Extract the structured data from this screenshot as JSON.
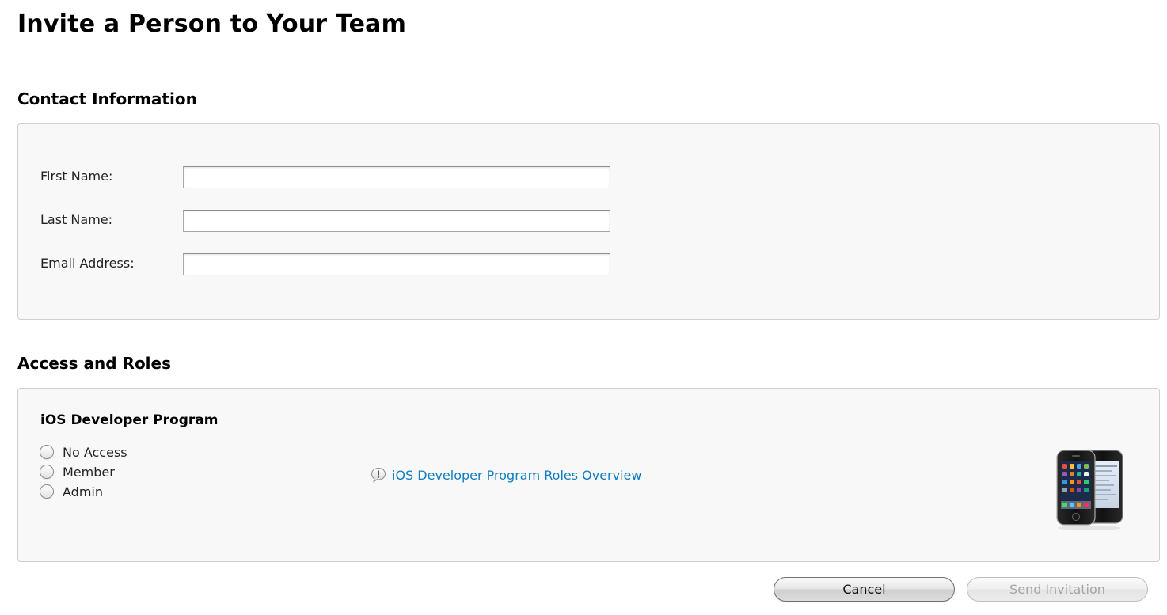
{
  "page": {
    "title": "Invite a Person to Your Team"
  },
  "contact": {
    "heading": "Contact Information",
    "fields": [
      {
        "label": "First Name:",
        "value": "",
        "name": "first-name"
      },
      {
        "label": "Last Name:",
        "value": "",
        "name": "last-name"
      },
      {
        "label": "Email Address:",
        "value": "",
        "name": "email-address"
      }
    ]
  },
  "access": {
    "heading": "Access and Roles",
    "program": {
      "heading": "iOS Developer Program",
      "options": [
        "No Access",
        "Member",
        "Admin"
      ],
      "selected": null,
      "roles_link": {
        "text": "iOS Developer Program Roles Overview",
        "icon": "info-bubble-icon"
      },
      "device_icon": "iphone-devices-icon"
    }
  },
  "actions": {
    "cancel_label": "Cancel",
    "send_label": "Send Invitation",
    "send_enabled": false
  },
  "colors": {
    "link": "#0f7dc2",
    "panel_bg": "#f8f8f8",
    "panel_border": "#cfcfcf",
    "disabled_text": "#a5a5a5"
  }
}
